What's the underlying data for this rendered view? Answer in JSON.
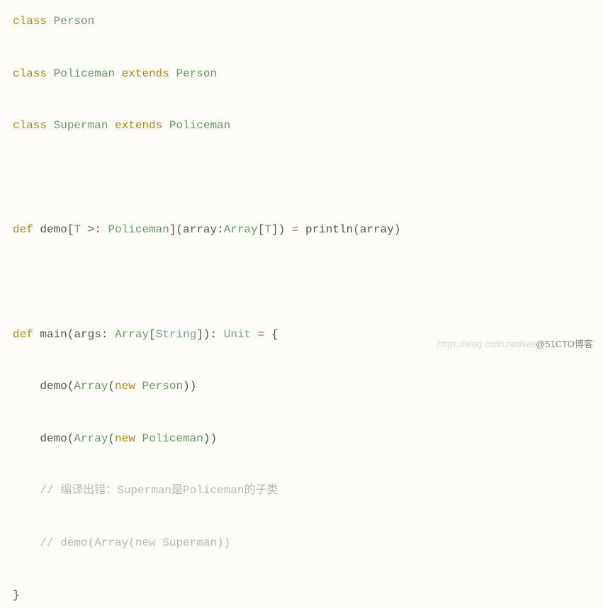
{
  "code": {
    "l1_kw_class": "class",
    "l1_type": "Person",
    "l2_kw_class": "class",
    "l2_type": "Policeman",
    "l2_kw_extends": "extends",
    "l2_super": "Person",
    "l3_kw_class": "class",
    "l3_type": "Superman",
    "l3_kw_extends": "extends",
    "l3_super": "Policeman",
    "l4_kw_def": "def",
    "l4_name": "demo",
    "l4_tparam_open": "[",
    "l4_tparam_t": "T",
    "l4_tparam_bound": ">:",
    "l4_tparam_type": "Policeman",
    "l4_tparam_close": "]",
    "l4_paren_open": "(",
    "l4_arg_name": "array",
    "l4_colon": ":",
    "l4_arg_type": "Array",
    "l4_arg_sub_open": "[",
    "l4_arg_sub_t": "T",
    "l4_arg_sub_close": "]",
    "l4_paren_close": ")",
    "l4_eq": "=",
    "l4_call": "println",
    "l4_call_open": "(",
    "l4_call_arg": "array",
    "l4_call_close": ")",
    "l5_kw_def": "def",
    "l5_name": "main",
    "l5_paren_open": "(",
    "l5_arg_name": "args",
    "l5_colon": ":",
    "l5_arg_type": "Array",
    "l5_arg_sub_open": "[",
    "l5_arg_sub_t": "String",
    "l5_arg_sub_close": "]",
    "l5_paren_close": ")",
    "l5_colon2": ":",
    "l5_ret": "Unit",
    "l5_eq": "=",
    "l5_brace": "{",
    "l6_call": "demo",
    "l6_open": "(",
    "l6_arr": "Array",
    "l6_aopen": "(",
    "l6_new": "new",
    "l6_type": "Person",
    "l6_aclose": ")",
    "l6_close": ")",
    "l7_call": "demo",
    "l7_open": "(",
    "l7_arr": "Array",
    "l7_aopen": "(",
    "l7_new": "new",
    "l7_type": "Policeman",
    "l7_aclose": ")",
    "l7_close": ")",
    "l8_comment": "// 编译出错：Superman是Policeman的子类",
    "l9_comment": "// demo(Array(new Superman))",
    "l10_brace": "}"
  },
  "watermark": {
    "faint": "https://blog.csdn.net/wei",
    "dark": "@51CTO博客"
  }
}
